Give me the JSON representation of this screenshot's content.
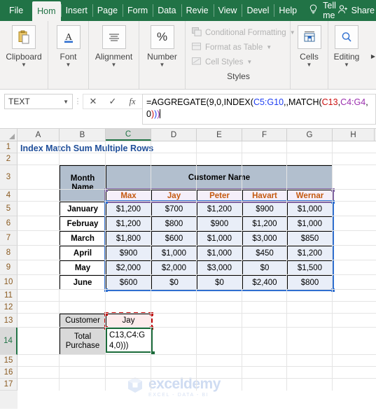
{
  "titlebar": {
    "tabs": [
      {
        "label": "File",
        "active": false
      },
      {
        "label": "Hom",
        "active": true
      },
      {
        "label": "Insert",
        "active": false
      },
      {
        "label": "Page",
        "active": false
      },
      {
        "label": "Form",
        "active": false
      },
      {
        "label": "Data",
        "active": false
      },
      {
        "label": "Revie",
        "active": false
      },
      {
        "label": "View",
        "active": false
      },
      {
        "label": "Devel",
        "active": false
      },
      {
        "label": "Help",
        "active": false
      }
    ],
    "tell_me": "Tell me",
    "share": "Share",
    "accent_color": "#217346"
  },
  "ribbon": {
    "groups": [
      {
        "label": "Clipboard",
        "icon": "clipboard-icon"
      },
      {
        "label": "Font",
        "icon": "font-a-icon"
      },
      {
        "label": "Alignment",
        "icon": "alignment-icon"
      },
      {
        "label": "Number",
        "icon": "percent-icon"
      }
    ],
    "styles": {
      "caption": "Styles",
      "items": [
        {
          "label": "Conditional Formatting",
          "icon": "conditional-formatting-icon"
        },
        {
          "label": "Format as Table",
          "icon": "format-as-table-icon"
        },
        {
          "label": "Cell Styles",
          "icon": "cell-styles-icon"
        }
      ]
    },
    "cells": {
      "label": "Cells",
      "icon": "cells-icon"
    },
    "editing": {
      "label": "Editing",
      "icon": "search-icon"
    }
  },
  "formula_bar": {
    "name_box": "TEXT",
    "cancel_icon": "close-icon",
    "enter_icon": "check-icon",
    "function_icon": "fx-icon",
    "formula_parts": [
      {
        "text": "=AGGREGATE(9,0,INDEX(",
        "color": "black"
      },
      {
        "text": "C5:G10",
        "color": "blue"
      },
      {
        "text": ",,MATCH(",
        "color": "black"
      },
      {
        "text": "C13",
        "color": "red"
      },
      {
        "text": ",",
        "color": "black"
      },
      {
        "text": "C4:G4",
        "color": "purple"
      },
      {
        "text": ",0",
        "color": "black"
      },
      {
        "text": ")",
        "color": "red"
      },
      {
        "text": ")",
        "color": "blue"
      },
      {
        "text": ")",
        "color": "purple"
      }
    ],
    "formula_text": "=AGGREGATE(9,0,INDEX(C5:G10,,MATCH(C13,C4:G4,0)))"
  },
  "grid": {
    "columns": [
      "A",
      "B",
      "C",
      "D",
      "E",
      "F",
      "G",
      "H"
    ],
    "selected_column": "C",
    "rows": [
      "1",
      "2",
      "3",
      "4",
      "5",
      "6",
      "7",
      "8",
      "9",
      "10",
      "11",
      "12",
      "13",
      "14",
      "15",
      "16",
      "17"
    ],
    "active_row": "14",
    "sheet_title": "Index Match Sum Multiple Rows"
  },
  "table": {
    "corner_header": "Month Name",
    "group_header": "Customer Name",
    "customers": [
      "Max",
      "Jay",
      "Peter",
      "Havart",
      "Wernar"
    ],
    "rows": [
      {
        "month": "January",
        "values": [
          "$1,200",
          "$700",
          "$1,200",
          "$900",
          "$1,000"
        ]
      },
      {
        "month": "Februay",
        "values": [
          "$1,200",
          "$800",
          "$900",
          "$1,200",
          "$1,000"
        ]
      },
      {
        "month": "March",
        "values": [
          "$1,800",
          "$600",
          "$1,000",
          "$3,000",
          "$850"
        ]
      },
      {
        "month": "April",
        "values": [
          "$900",
          "$1,000",
          "$1,000",
          "$450",
          "$1,200"
        ]
      },
      {
        "month": "May",
        "values": [
          "$2,000",
          "$2,000",
          "$3,000",
          "$0",
          "$1,500"
        ]
      },
      {
        "month": "June",
        "values": [
          "$600",
          "$0",
          "$0",
          "$2,400",
          "$800"
        ]
      }
    ]
  },
  "lookup": {
    "customer_label": "Customer",
    "customer_value": "Jay",
    "total_label_line1": "Total",
    "total_label_line2": "Purchase",
    "active_cell_text": "C13,C4:G4,0)))"
  },
  "watermark": {
    "name": "exceldemy",
    "tagline": "EXCEL - DATA - BI"
  },
  "colors": {
    "excel_green": "#217346",
    "selection_blue": "#2f6fd0",
    "selection_purple": "#8064a2",
    "selection_red": "#c00000",
    "active_green": "#1b6b3a",
    "customer_orange": "#c55a11",
    "title_blue": "#1f4e99",
    "header_grey_blue": "#b2bfce"
  }
}
